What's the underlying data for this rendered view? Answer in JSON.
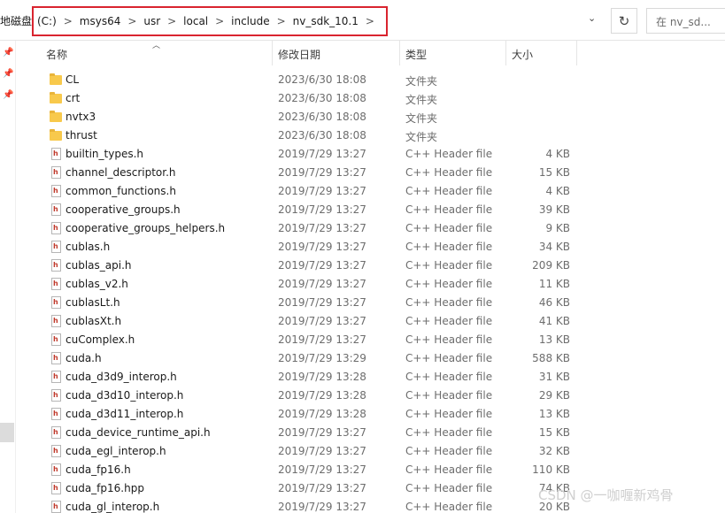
{
  "address": {
    "prefix": "地磁盘",
    "crumbs": [
      "(C:)",
      "msys64",
      "usr",
      "local",
      "include",
      "nv_sdk_10.1"
    ],
    "separator": ">",
    "dropdown_glyph": "⌄",
    "refresh_glyph": "↻"
  },
  "search": {
    "placeholder": "在 nv_sd..."
  },
  "columns": {
    "name": "名称",
    "date": "修改日期",
    "type": "类型",
    "size": "大小"
  },
  "files": [
    {
      "name": "CL",
      "date": "2023/6/30 18:08",
      "type": "文件夹",
      "size": "",
      "kind": "folder"
    },
    {
      "name": "crt",
      "date": "2023/6/30 18:08",
      "type": "文件夹",
      "size": "",
      "kind": "folder"
    },
    {
      "name": "nvtx3",
      "date": "2023/6/30 18:08",
      "type": "文件夹",
      "size": "",
      "kind": "folder"
    },
    {
      "name": "thrust",
      "date": "2023/6/30 18:08",
      "type": "文件夹",
      "size": "",
      "kind": "folder"
    },
    {
      "name": "builtin_types.h",
      "date": "2019/7/29 13:27",
      "type": "C++ Header file",
      "size": "4 KB",
      "kind": "header"
    },
    {
      "name": "channel_descriptor.h",
      "date": "2019/7/29 13:27",
      "type": "C++ Header file",
      "size": "15 KB",
      "kind": "header"
    },
    {
      "name": "common_functions.h",
      "date": "2019/7/29 13:27",
      "type": "C++ Header file",
      "size": "4 KB",
      "kind": "header"
    },
    {
      "name": "cooperative_groups.h",
      "date": "2019/7/29 13:27",
      "type": "C++ Header file",
      "size": "39 KB",
      "kind": "header"
    },
    {
      "name": "cooperative_groups_helpers.h",
      "date": "2019/7/29 13:27",
      "type": "C++ Header file",
      "size": "9 KB",
      "kind": "header"
    },
    {
      "name": "cublas.h",
      "date": "2019/7/29 13:27",
      "type": "C++ Header file",
      "size": "34 KB",
      "kind": "header"
    },
    {
      "name": "cublas_api.h",
      "date": "2019/7/29 13:27",
      "type": "C++ Header file",
      "size": "209 KB",
      "kind": "header"
    },
    {
      "name": "cublas_v2.h",
      "date": "2019/7/29 13:27",
      "type": "C++ Header file",
      "size": "11 KB",
      "kind": "header"
    },
    {
      "name": "cublasLt.h",
      "date": "2019/7/29 13:27",
      "type": "C++ Header file",
      "size": "46 KB",
      "kind": "header"
    },
    {
      "name": "cublasXt.h",
      "date": "2019/7/29 13:27",
      "type": "C++ Header file",
      "size": "41 KB",
      "kind": "header"
    },
    {
      "name": "cuComplex.h",
      "date": "2019/7/29 13:27",
      "type": "C++ Header file",
      "size": "13 KB",
      "kind": "header"
    },
    {
      "name": "cuda.h",
      "date": "2019/7/29 13:29",
      "type": "C++ Header file",
      "size": "588 KB",
      "kind": "header"
    },
    {
      "name": "cuda_d3d9_interop.h",
      "date": "2019/7/29 13:28",
      "type": "C++ Header file",
      "size": "31 KB",
      "kind": "header"
    },
    {
      "name": "cuda_d3d10_interop.h",
      "date": "2019/7/29 13:28",
      "type": "C++ Header file",
      "size": "29 KB",
      "kind": "header"
    },
    {
      "name": "cuda_d3d11_interop.h",
      "date": "2019/7/29 13:28",
      "type": "C++ Header file",
      "size": "13 KB",
      "kind": "header"
    },
    {
      "name": "cuda_device_runtime_api.h",
      "date": "2019/7/29 13:27",
      "type": "C++ Header file",
      "size": "15 KB",
      "kind": "header"
    },
    {
      "name": "cuda_egl_interop.h",
      "date": "2019/7/29 13:27",
      "type": "C++ Header file",
      "size": "32 KB",
      "kind": "header"
    },
    {
      "name": "cuda_fp16.h",
      "date": "2019/7/29 13:27",
      "type": "C++ Header file",
      "size": "110 KB",
      "kind": "header"
    },
    {
      "name": "cuda_fp16.hpp",
      "date": "2019/7/29 13:27",
      "type": "C++ Header file",
      "size": "74 KB",
      "kind": "header"
    },
    {
      "name": "cuda_gl_interop.h",
      "date": "2019/7/29 13:27",
      "type": "C++ Header file",
      "size": "20 KB",
      "kind": "header"
    }
  ],
  "watermark": "CSDN @一咖喱新鸡骨",
  "colors": {
    "highlight_border": "#d9242f",
    "folder": "#f8c94c",
    "header_icon": "#c0392b"
  }
}
